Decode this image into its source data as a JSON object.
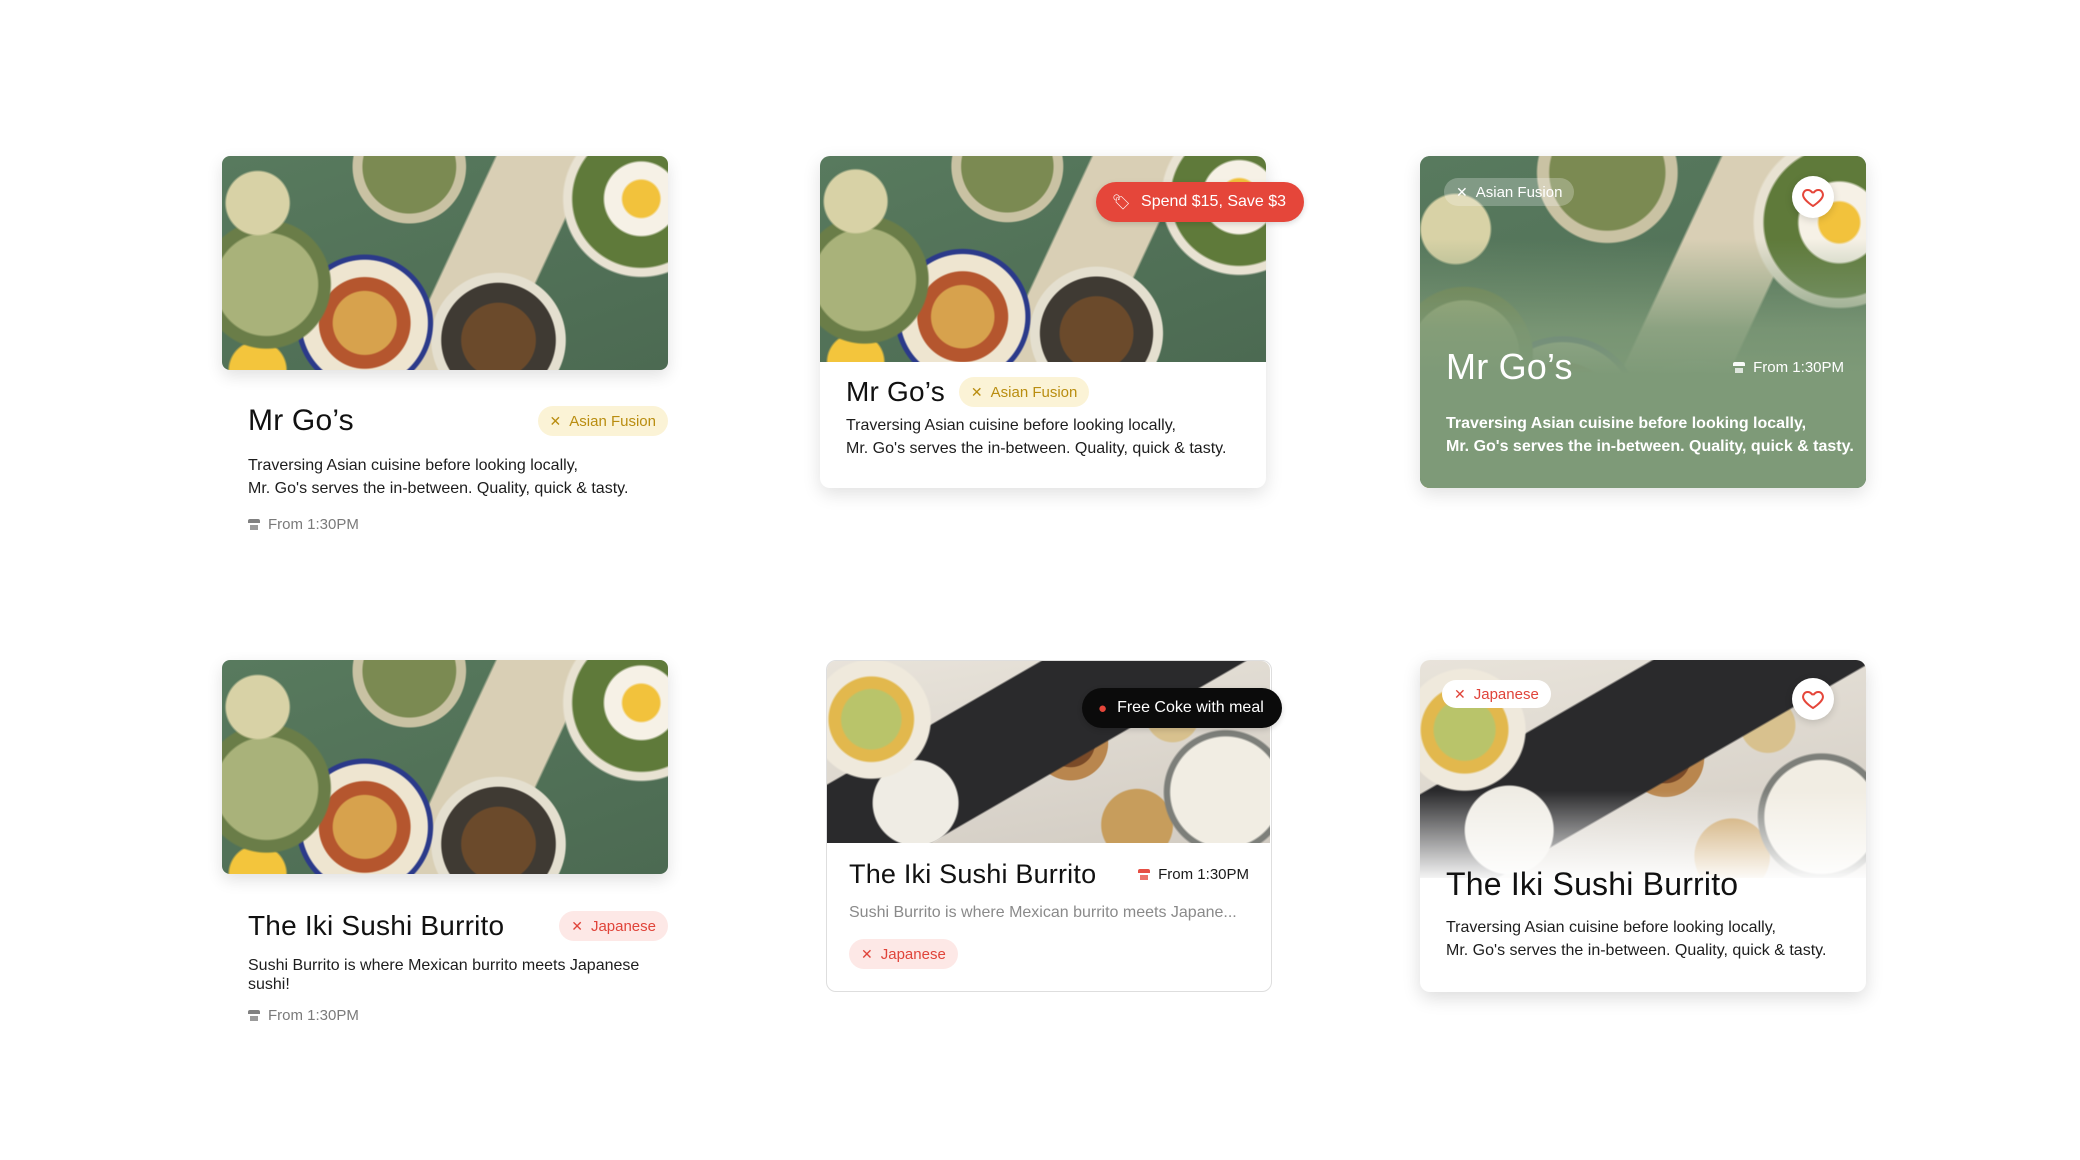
{
  "card1": {
    "title": "Mr Go’s",
    "tag": "Asian Fusion",
    "description_line1": "Traversing Asian cuisine before looking locally,",
    "description_line2": "Mr. Go's serves the in-between. Quality, quick & tasty.",
    "time": "From 1:30PM"
  },
  "card2": {
    "promo": "Spend $15, Save $3",
    "title": "Mr Go’s",
    "tag": "Asian Fusion",
    "description_line1": "Traversing Asian cuisine before looking locally,",
    "description_line2": "Mr. Go's serves the in-between. Quality, quick & tasty."
  },
  "card3": {
    "tag": "Asian Fusion",
    "title": "Mr Go’s",
    "time": "From 1:30PM",
    "description_line1": "Traversing Asian cuisine before looking locally,",
    "description_line2": "Mr. Go's serves the in-between. Quality, quick & tasty."
  },
  "card4": {
    "title": "The Iki Sushi Burrito",
    "tag": "Japanese",
    "description": "Sushi Burrito is where Mexican burrito meets Japanese sushi!",
    "time": "From 1:30PM"
  },
  "card5": {
    "promo": "Free Coke with meal",
    "title": "The Iki Sushi Burrito",
    "time": "From 1:30PM",
    "description": "Sushi Burrito is where Mexican burrito meets Japane...",
    "tag": "Japanese"
  },
  "card6": {
    "tag": "Japanese",
    "title": "The Iki Sushi Burrito",
    "description_line1": "Traversing Asian cuisine before looking locally,",
    "description_line2": "Mr. Go's serves the in-between. Quality, quick & tasty."
  },
  "colors": {
    "accent_red": "#e5463a",
    "tag_yellow": "#b98d10",
    "sage_green": "#7e9a78",
    "promo_black": "#0b0b0b"
  },
  "icons": {
    "cuisine": "utensils-cross-icon",
    "store": "store-icon",
    "promo": "price-tag-icon",
    "favorite": "heart-outline-icon"
  }
}
